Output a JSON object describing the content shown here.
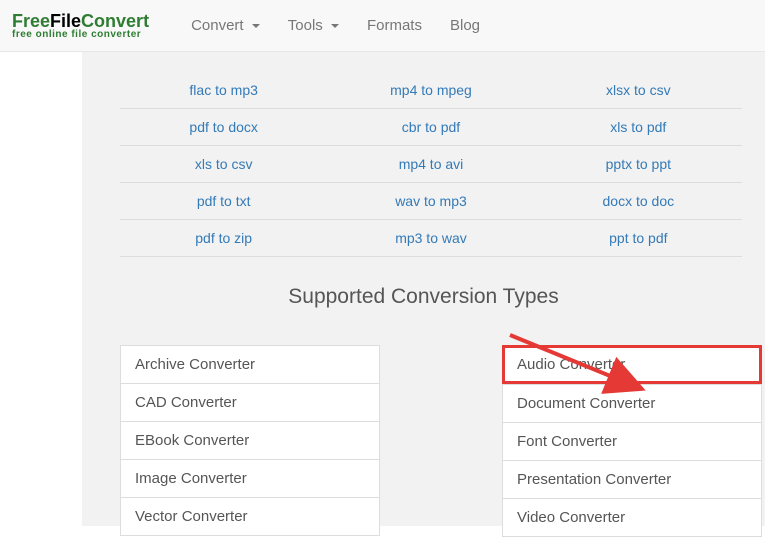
{
  "brand": {
    "part1": "Free",
    "part2": "File",
    "part3": "Convert",
    "subtitle": "free online file converter"
  },
  "nav": {
    "convert": "Convert",
    "tools": "Tools",
    "formats": "Formats",
    "blog": "Blog"
  },
  "conversions": {
    "rows": [
      {
        "c0": "flac to mp3",
        "c1": "mp4 to mpeg",
        "c2": "xlsx to csv"
      },
      {
        "c0": "pdf to docx",
        "c1": "cbr to pdf",
        "c2": "xls to pdf"
      },
      {
        "c0": "xls to csv",
        "c1": "mp4 to avi",
        "c2": "pptx to ppt"
      },
      {
        "c0": "pdf to txt",
        "c1": "wav to mp3",
        "c2": "docx to doc"
      },
      {
        "c0": "pdf to zip",
        "c1": "mp3 to wav",
        "c2": "ppt to pdf"
      }
    ]
  },
  "heading": "Supported Conversion Types",
  "types": {
    "left": [
      "Archive Converter",
      "CAD Converter",
      "EBook Converter",
      "Image Converter",
      "Vector Converter"
    ],
    "right": [
      "Audio Converter",
      "Document Converter",
      "Font Converter",
      "Presentation Converter",
      "Video Converter"
    ]
  }
}
